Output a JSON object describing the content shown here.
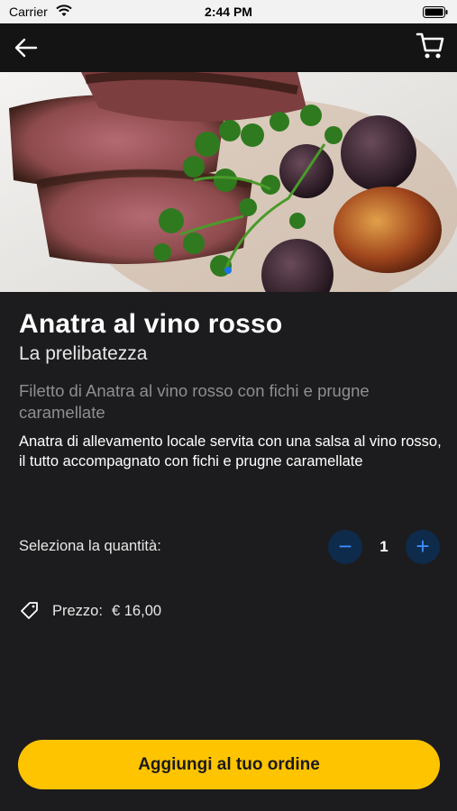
{
  "status_bar": {
    "carrier": "Carrier",
    "time": "2:44 PM"
  },
  "nav": {
    "back_icon": "arrow-left-icon",
    "cart_icon": "cart-icon"
  },
  "product": {
    "title": "Anatra al vino rosso",
    "subtitle": "La prelibatezza",
    "short_description": "Filetto di Anatra al vino rosso con fichi e prugne caramellate",
    "long_description": "Anatra di allevamento locale servita con una salsa al vino rosso, il tutto accompagnato con fichi e prugne caramellate"
  },
  "quantity": {
    "label": "Seleziona la quantità:",
    "value": "1",
    "minus": "−",
    "plus": "+"
  },
  "price": {
    "label": "Prezzo:",
    "value": "€ 16,00"
  },
  "cta": {
    "label": "Aggiungi al tuo ordine"
  },
  "colors": {
    "background": "#1c1c1e",
    "nav": "#141414",
    "accent": "#ffc400",
    "stepper": "#0e2b4c",
    "stepper_icon": "#3d8cff"
  }
}
